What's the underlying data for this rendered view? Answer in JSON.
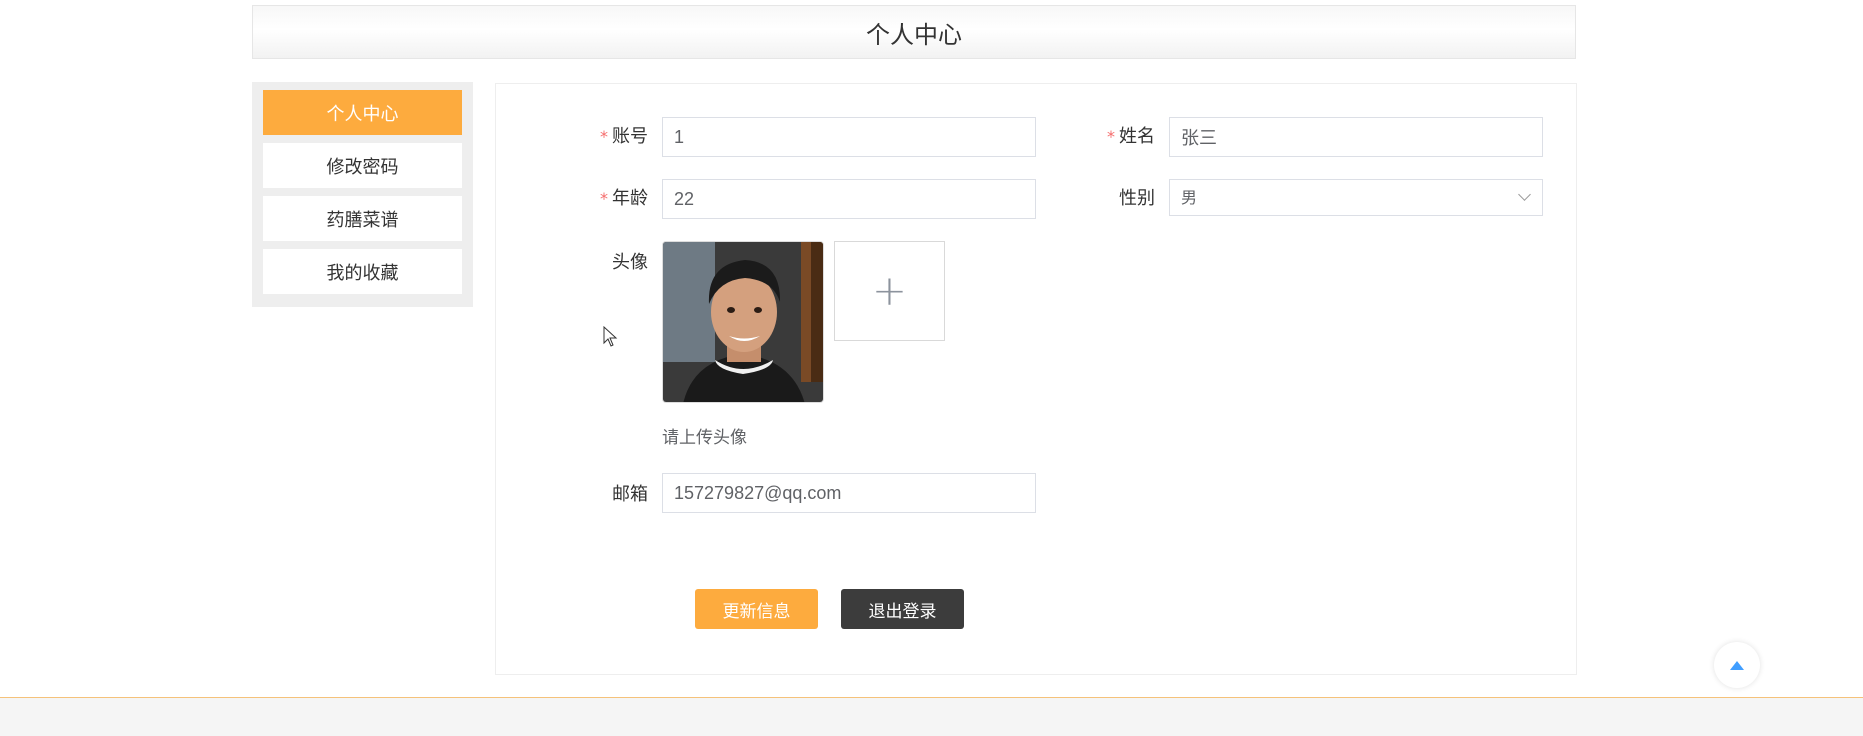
{
  "page": {
    "title": "个人中心"
  },
  "sidebar": {
    "items": [
      {
        "label": "个人中心"
      },
      {
        "label": "修改密码"
      },
      {
        "label": "药膳菜谱"
      },
      {
        "label": "我的收藏"
      }
    ]
  },
  "form": {
    "account": {
      "label": "账号",
      "required": "*",
      "value": "1"
    },
    "name": {
      "label": "姓名",
      "required": "*",
      "value": "张三"
    },
    "age": {
      "label": "年龄",
      "required": "*",
      "value": "22"
    },
    "gender": {
      "label": "性别",
      "value": "男"
    },
    "avatar": {
      "label": "头像",
      "hint": "请上传头像"
    },
    "email": {
      "label": "邮箱",
      "value": "157279827@qq.com"
    }
  },
  "buttons": {
    "update": "更新信息",
    "logout": "退出登录"
  },
  "colors": {
    "accent": "#fdab3e",
    "dark_button": "#3c3c3c",
    "required": "#f56c6c"
  },
  "icons": {
    "upload": "plus-icon",
    "dropdown": "chevron-down-icon",
    "back_to_top": "caret-up-icon"
  }
}
